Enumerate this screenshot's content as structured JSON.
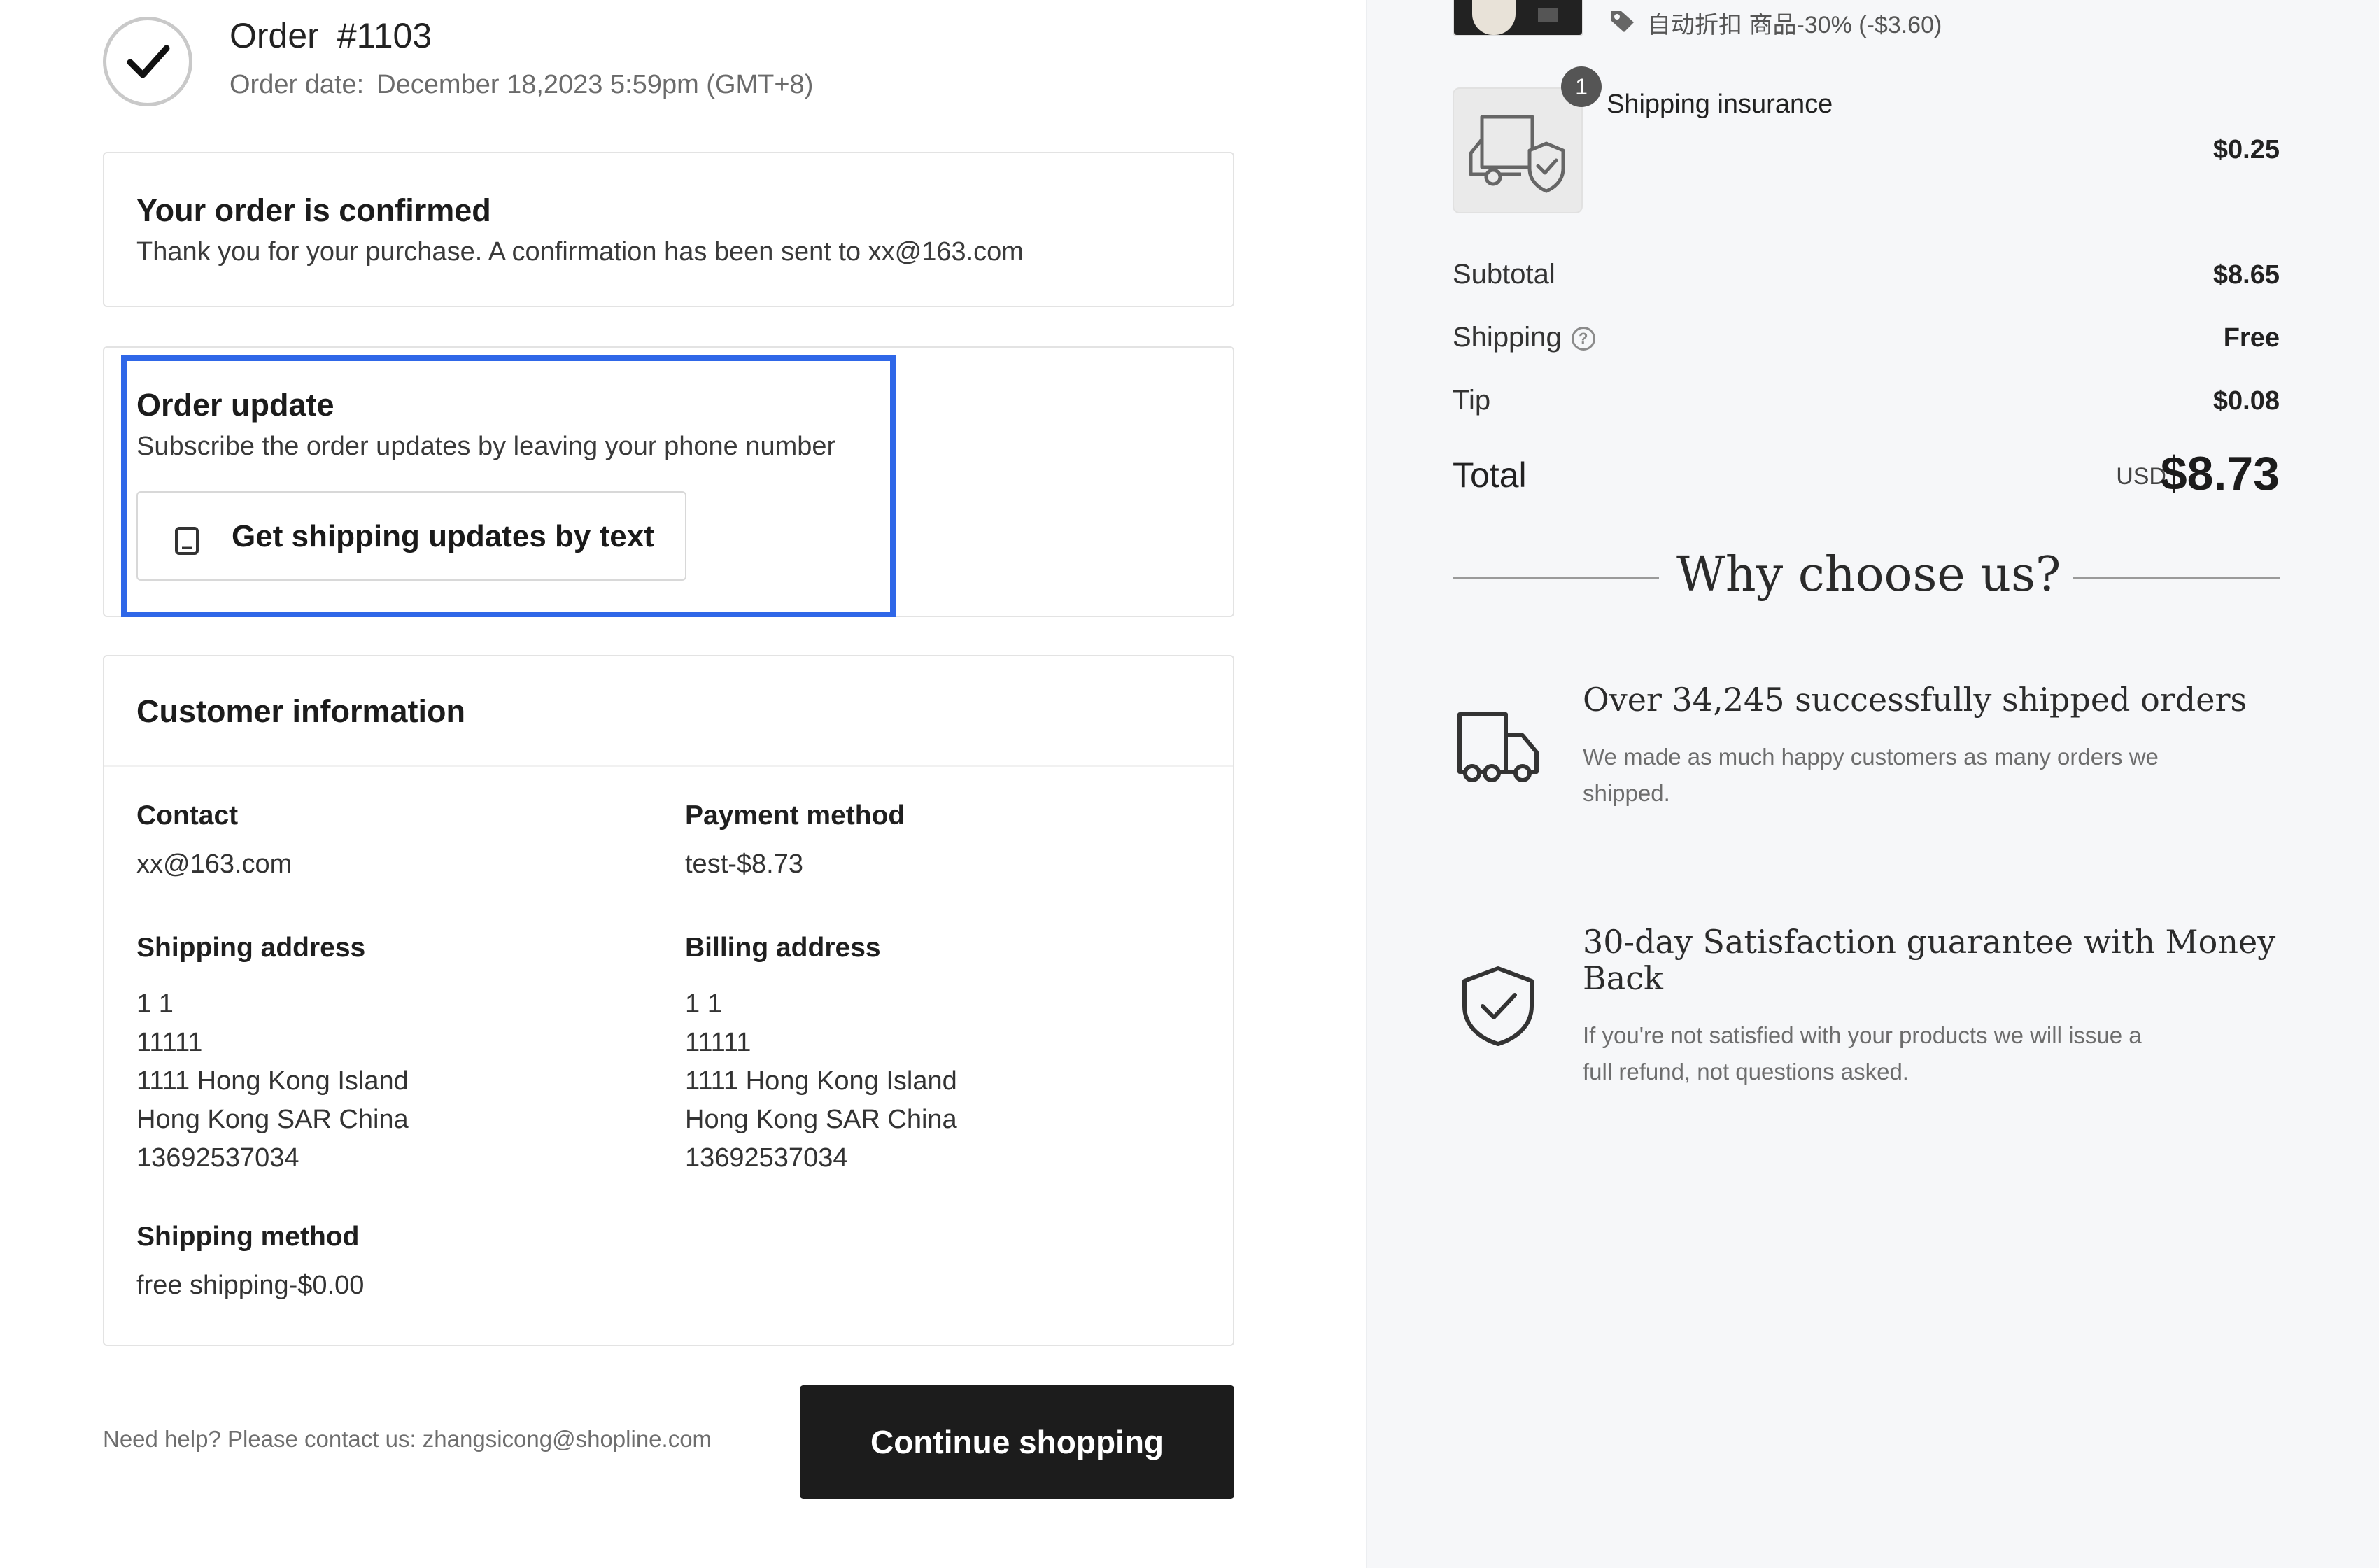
{
  "order": {
    "label": "Order",
    "number": "#1103",
    "date_label": "Order date:",
    "date_value": "December 18,2023 5:59pm (GMT+8)"
  },
  "confirmed": {
    "title": "Your order is confirmed",
    "message": "Thank you for your purchase. A confirmation has been sent to xx@163.com"
  },
  "order_update": {
    "title": "Order update",
    "message": "Subscribe the order updates by leaving your phone number",
    "button_label": "Get shipping updates by text"
  },
  "customer": {
    "title": "Customer information",
    "contact_label": "Contact",
    "contact_value": "xx@163.com",
    "payment_label": "Payment method",
    "payment_value": "test-$8.73",
    "shipping_address_label": "Shipping address",
    "shipping_address_lines": [
      "1 1",
      "11111",
      "1111 Hong Kong Island",
      "Hong Kong SAR China",
      "13692537034"
    ],
    "billing_address_label": "Billing address",
    "billing_address_lines": [
      "1 1",
      "11111",
      "1111 Hong Kong Island",
      "Hong Kong SAR China",
      "13692537034"
    ],
    "shipping_method_label": "Shipping method",
    "shipping_method_value": "free shipping-$0.00"
  },
  "footer": {
    "help_text": "Need help? Please contact us: zhangsicong@shopline.com",
    "continue_label": "Continue shopping"
  },
  "summary": {
    "discount_text": "自动折扣 商品-30% (-$3.60)",
    "insurance_badge": "1",
    "insurance_name": "Shipping insurance",
    "insurance_price": "$0.25",
    "subtotal_label": "Subtotal",
    "subtotal_value": "$8.65",
    "shipping_label": "Shipping",
    "shipping_help_icon": "?",
    "shipping_value": "Free",
    "tip_label": "Tip",
    "tip_value": "$0.08",
    "total_label": "Total",
    "total_currency": "USD",
    "total_value": "$8.73"
  },
  "why": {
    "title": "Why choose us?",
    "features": [
      {
        "icon": "truck-icon",
        "title": "Over 34,245 successfully shipped orders",
        "desc_lines": [
          "We made as much happy customers as many orders we",
          "shipped."
        ]
      },
      {
        "icon": "shield-check-icon",
        "title_lines": [
          "30-day Satisfaction guarantee with Money",
          "Back"
        ],
        "desc_lines": [
          "If you're not satisfied with your products we will issue a",
          "full refund, not questions asked."
        ]
      }
    ]
  },
  "colors": {
    "highlight": "#2f67e8",
    "button_dark": "#1c1c1c",
    "sidebar_bg": "#f6f7f9"
  }
}
